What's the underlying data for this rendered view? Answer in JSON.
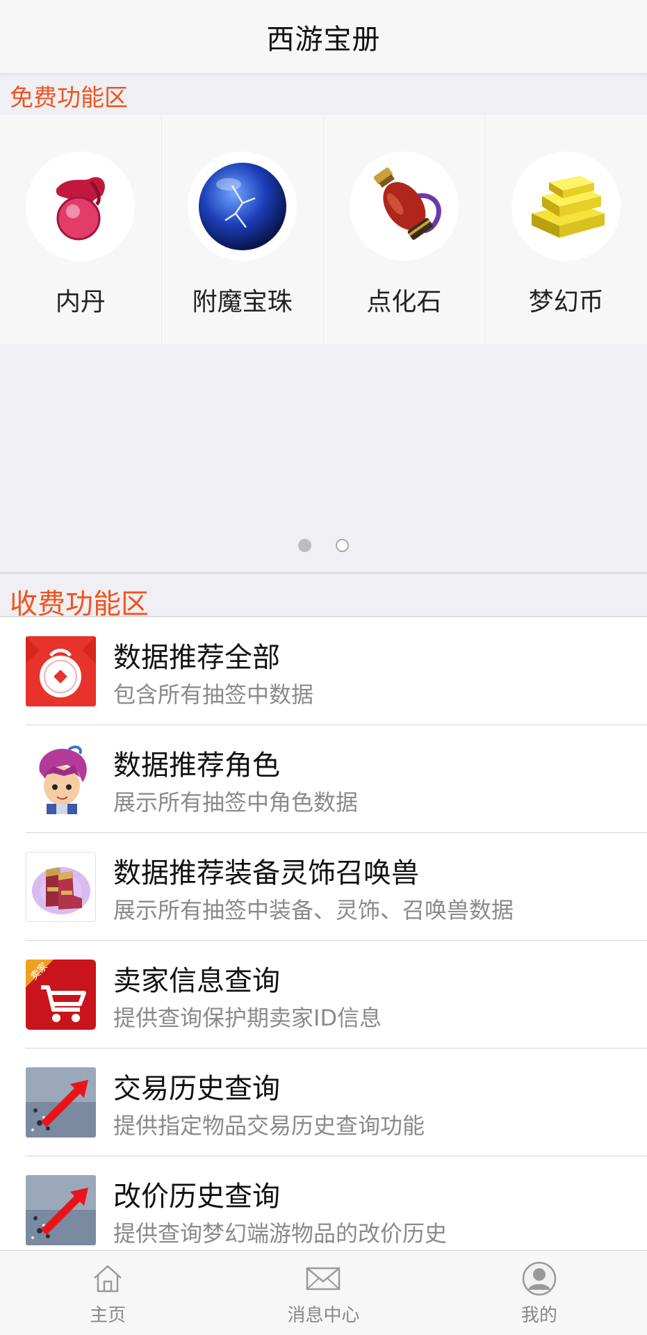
{
  "header": {
    "title": "西游宝册"
  },
  "free_section": {
    "title": "免费功能区",
    "items": [
      {
        "label": "内丹",
        "icon": "neidan-orb-icon"
      },
      {
        "label": "附魔宝珠",
        "icon": "blue-pearl-icon"
      },
      {
        "label": "点化石",
        "icon": "vase-stone-icon"
      },
      {
        "label": "梦幻币",
        "icon": "gold-bars-icon"
      }
    ],
    "pager": {
      "pages": 2,
      "current": 1
    }
  },
  "paid_section": {
    "title": "收费功能区",
    "items": [
      {
        "title": "数据推荐全部",
        "subtitle": "包含所有抽签中数据",
        "icon": "red-envelope-icon"
      },
      {
        "title": "数据推荐角色",
        "subtitle": "展示所有抽签中角色数据",
        "icon": "character-avatar-icon"
      },
      {
        "title": "数据推荐装备灵饰召唤兽",
        "subtitle": "展示所有抽签中装备、灵饰、召唤兽数据",
        "icon": "boots-icon"
      },
      {
        "title": "卖家信息查询",
        "subtitle": "提供查询保护期卖家ID信息",
        "icon": "shopping-cart-icon",
        "badge": "卖家"
      },
      {
        "title": "交易历史查询",
        "subtitle": "提供指定物品交易历史查询功能",
        "icon": "red-arrow-icon"
      },
      {
        "title": "改价历史查询",
        "subtitle": "提供查询梦幻端游物品的改价历史",
        "icon": "red-arrow-icon"
      }
    ]
  },
  "tabbar": {
    "tabs": [
      {
        "label": "主页",
        "icon": "home-icon"
      },
      {
        "label": "消息中心",
        "icon": "mail-icon"
      },
      {
        "label": "我的",
        "icon": "user-icon"
      }
    ]
  },
  "colors": {
    "accent": "#f0541e",
    "background": "#efeff4"
  }
}
